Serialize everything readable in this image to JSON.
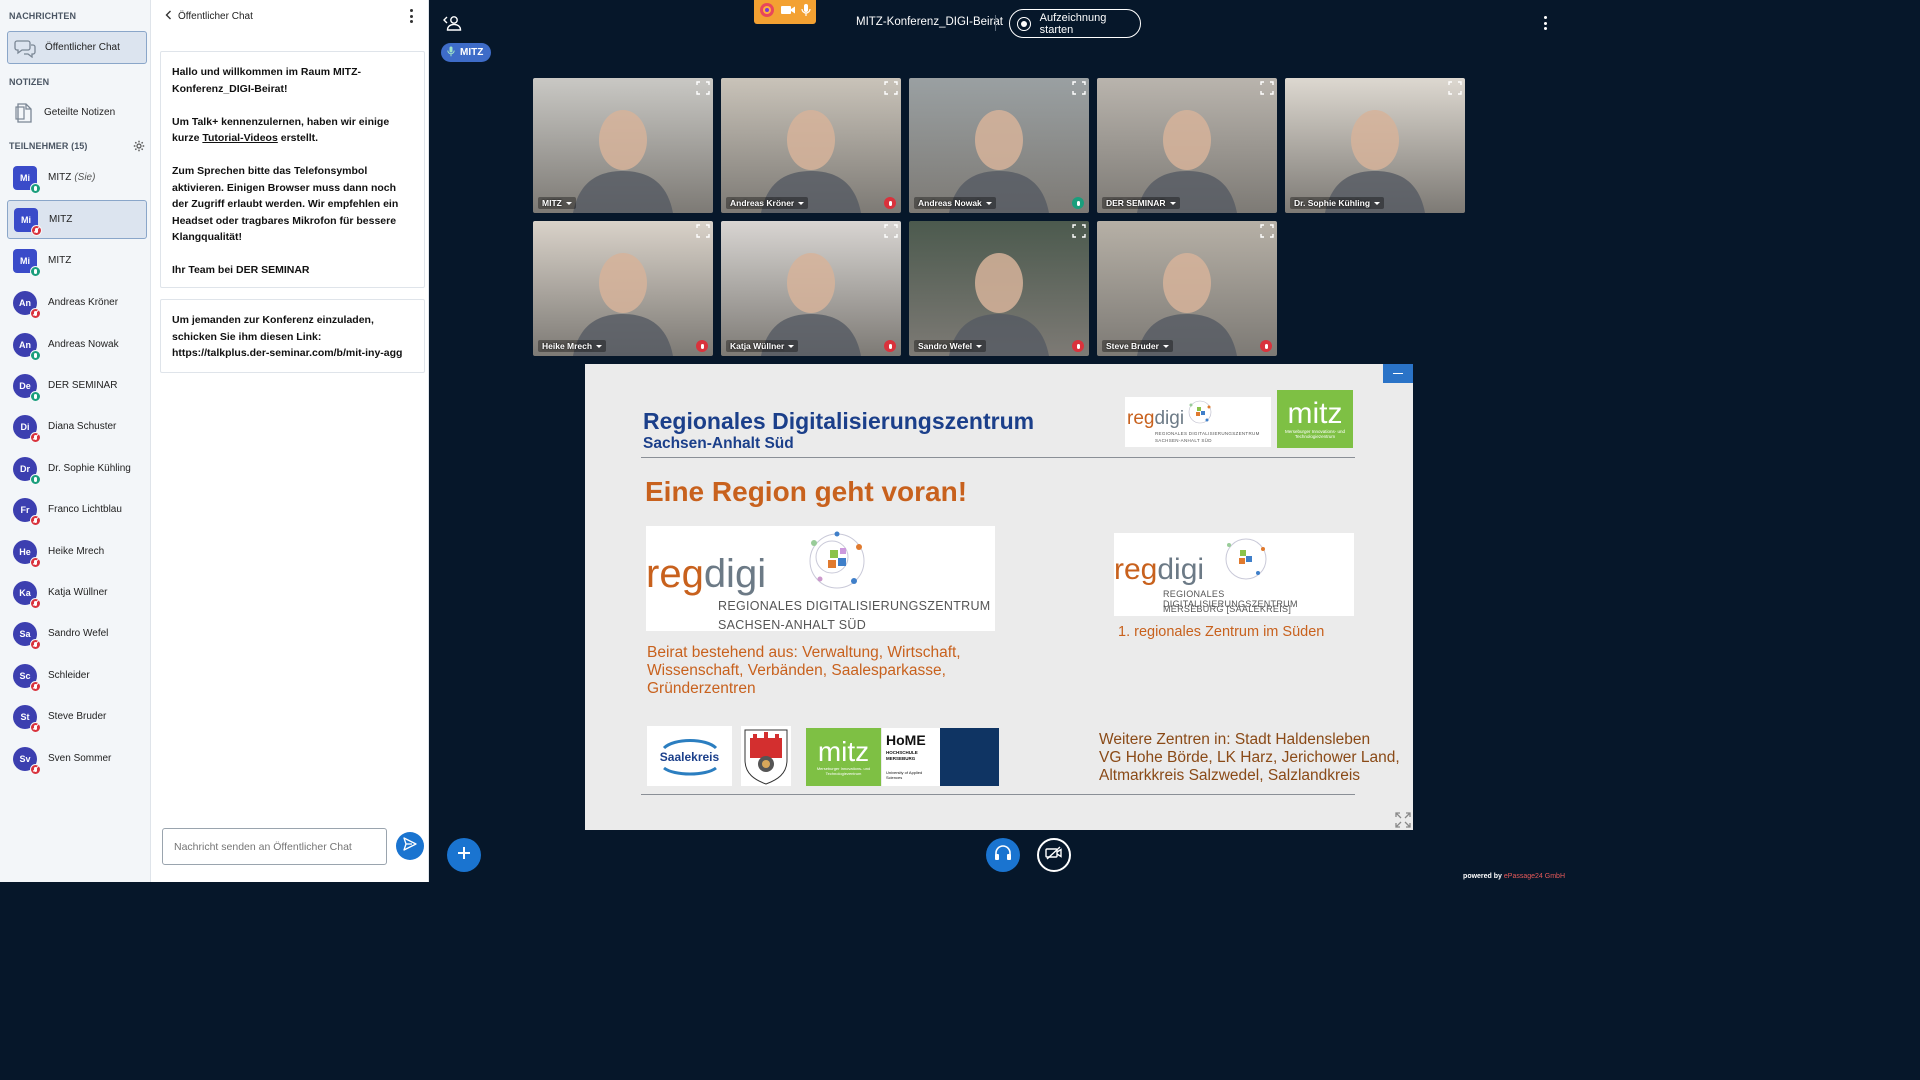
{
  "sidebar": {
    "messages_heading": "NACHRICHTEN",
    "public_chat_label": "Öffentlicher Chat",
    "notes_heading": "NOTIZEN",
    "shared_notes_label": "Geteilte Notizen",
    "participants_heading": "TEILNEHMER (15)",
    "users": [
      {
        "initials": "Mi",
        "name": "MITZ",
        "suffix": "(Sie)",
        "mic": "on",
        "shape": "sq"
      },
      {
        "initials": "Mi",
        "name": "MITZ",
        "suffix": "",
        "mic": "off",
        "shape": "sq"
      },
      {
        "initials": "Mi",
        "name": "MITZ",
        "suffix": "",
        "mic": "on",
        "shape": "sq"
      },
      {
        "initials": "An",
        "name": "Andreas Kröner",
        "suffix": "",
        "mic": "off",
        "shape": "round"
      },
      {
        "initials": "An",
        "name": "Andreas Nowak",
        "suffix": "",
        "mic": "on",
        "shape": "round"
      },
      {
        "initials": "De",
        "name": "DER SEMINAR",
        "suffix": "",
        "mic": "on",
        "shape": "round"
      },
      {
        "initials": "Di",
        "name": "Diana Schuster",
        "suffix": "",
        "mic": "off",
        "shape": "round"
      },
      {
        "initials": "Dr",
        "name": "Dr. Sophie Kühling",
        "suffix": "",
        "mic": "on",
        "shape": "round"
      },
      {
        "initials": "Fr",
        "name": "Franco Lichtblau",
        "suffix": "",
        "mic": "off",
        "shape": "round"
      },
      {
        "initials": "He",
        "name": "Heike Mrech",
        "suffix": "",
        "mic": "off",
        "shape": "round"
      },
      {
        "initials": "Ka",
        "name": "Katja Wüllner",
        "suffix": "",
        "mic": "off",
        "shape": "round"
      },
      {
        "initials": "Sa",
        "name": "Sandro Wefel",
        "suffix": "",
        "mic": "off",
        "shape": "round"
      },
      {
        "initials": "Sc",
        "name": "Schleider",
        "suffix": "",
        "mic": "off",
        "shape": "round"
      },
      {
        "initials": "St",
        "name": "Steve Bruder",
        "suffix": "",
        "mic": "off",
        "shape": "round"
      },
      {
        "initials": "Sv",
        "name": "Sven Sommer",
        "suffix": "",
        "mic": "off",
        "shape": "round"
      }
    ]
  },
  "chat": {
    "title": "Öffentlicher Chat",
    "welcome": {
      "line1": "Hallo und willkommen im Raum MITZ-Konferenz_DIGI-Beirat!",
      "line2a": "Um Talk+ kennenzulernen, haben wir einige kurze ",
      "line2link": "Tutorial-Videos",
      "line2b": " erstellt.",
      "line3": "Zum Sprechen bitte das Telefonsymbol aktivieren. Einigen Browser muss dann noch der Zugriff erlaubt werden. Wir empfehlen ein Headset oder tragbares Mikrofon für bessere Klangqualität!",
      "line4": "Ihr Team bei DER SEMINAR"
    },
    "invite": "Um jemanden zur Konferenz einzuladen, schicken Sie ihm diesen Link: https://talkplus.der-seminar.com/b/mit-iny-agg",
    "input_placeholder": "Nachricht senden an Öffentlicher Chat"
  },
  "topbar": {
    "meeting_title": "MITZ-Konferenz_DIGI-Beirat",
    "record_label": "Aufzeichnung starten",
    "speaker_label": "MITZ"
  },
  "videos": [
    {
      "name": "MITZ",
      "mic": "none",
      "bg": "#c9c8c4"
    },
    {
      "name": "Andreas Kröner",
      "mic": "off",
      "bg": "#c9c3b9"
    },
    {
      "name": "Andreas Nowak",
      "mic": "on",
      "bg": "#9aa0a2"
    },
    {
      "name": "DER SEMINAR",
      "mic": "none",
      "bg": "#b9b4ad"
    },
    {
      "name": "Dr. Sophie Kühling",
      "mic": "none",
      "bg": "#ddd8d0"
    },
    {
      "name": "Heike Mrech",
      "mic": "off",
      "bg": "#d9d2c9"
    },
    {
      "name": "Katja Wüllner",
      "mic": "off",
      "bg": "#d8d5d2"
    },
    {
      "name": "Sandro Wefel",
      "mic": "off",
      "bg": "#4c5a4e"
    },
    {
      "name": "Steve Bruder",
      "mic": "off",
      "bg": "#b6b0a6"
    }
  ],
  "slide": {
    "title": "Regionales Digitalisierungszentrum",
    "subtitle": "Sachsen-Anhalt Süd",
    "headline": "Eine Region geht voran!",
    "regdigi_reg": "reg",
    "regdigi_digi": "digi",
    "regdigi_line1": "REGIONALES DIGITALISIERUNGSZENTRUM",
    "regdigi_line2": "SACHSEN-ANHALT SÜD",
    "regdigi_merseburg_line2": "MERSEBURG [SAALEKREIS]",
    "mitz_word": "mitz",
    "mitz_sub": "Merseburger Innovations- und Technologiezentrum",
    "home_word": "HoME",
    "home_sub": "HOCHSCHULE MERSEBURG",
    "home_sub2": "University of Applied Sciences",
    "saalekreis": "Saalekreis",
    "first_center": "1. regionales Zentrum im Süden",
    "board_text": "Beirat bestehend aus: Verwaltung, Wirtschaft, Wissenschaft, Verbänden, Saalesparkasse, Gründerzentren",
    "board_line1": "Beirat bestehend aus: Verwaltung, Wirtschaft,",
    "board_line2": "Wissenschaft, Verbänden, Saalesparkasse,",
    "board_line3": "Gründerzentren",
    "further_line1": "Weitere Zentren in: Stadt Haldensleben",
    "further_line2": "VG Hohe Börde, LK Harz, Jerichower Land,",
    "further_line3": "Altmarkkreis Salzwedel, Salzlandkreis"
  },
  "footer": {
    "powered_prefix": "powered by",
    "powered_brand": "ePassage24 GmbH"
  },
  "colors": {
    "accent": "#1a74d0",
    "mic_on": "#1a9e7c",
    "mic_off": "#d9323c",
    "slide_title": "#1b3f8a",
    "slide_orange": "#c8611d",
    "background": "#06172a"
  }
}
